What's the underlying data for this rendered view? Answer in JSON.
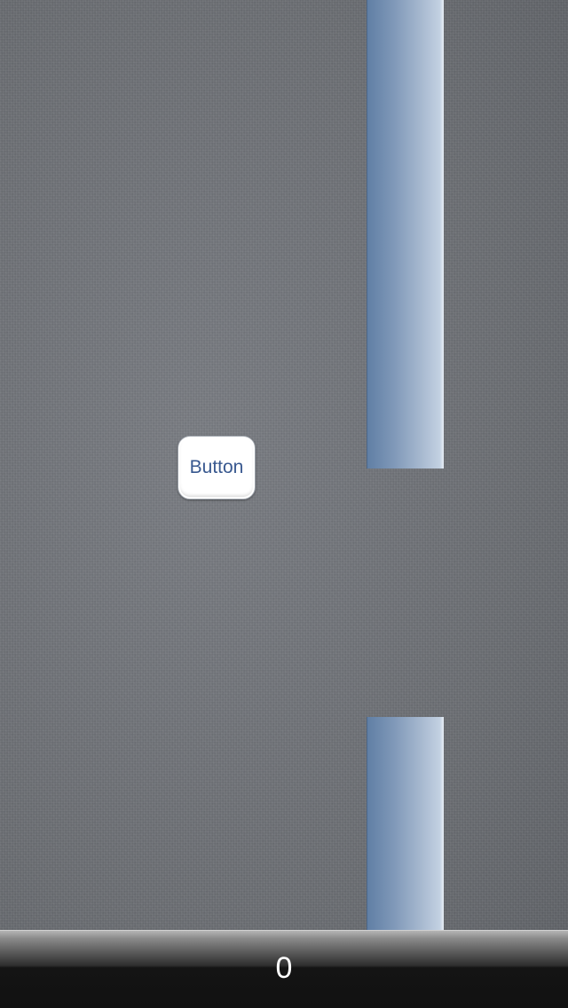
{
  "game": {
    "player_button_label": "Button",
    "score": "0",
    "pipe_color_dark": "#5f7ea4",
    "pipe_color_light": "#e8eef5",
    "score_bar_color": "#111111",
    "button_text_color": "#38588f"
  }
}
